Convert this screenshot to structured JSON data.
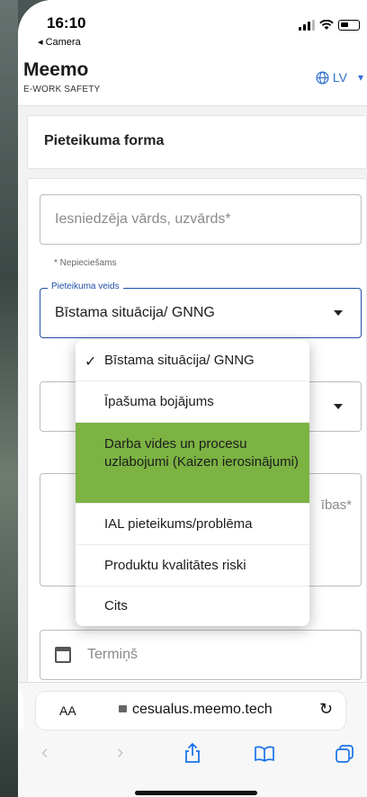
{
  "status_bar": {
    "time": "16:10",
    "back_app": "◂ Camera"
  },
  "app": {
    "name": "Meemo",
    "subtitle": "E-WORK SAFETY",
    "language": "LV"
  },
  "form": {
    "title": "Pieteikuma forma",
    "name_placeholder": "Iesniedzēja vārds, uzvārds*",
    "required_helper": "* Nepieciešams",
    "type_label": "Pieteikuma veids",
    "type_value": "Bīstama situācija/ GNNG",
    "description_tail": "ības*",
    "deadline_placeholder": "Termiņš"
  },
  "dropdown": {
    "options": [
      "Bīstama situācija/ GNNG",
      "Īpašuma bojājums",
      "Darba vides un procesu uzlabojumi (Kaizen ierosinājumi)",
      "IAL pieteikums/problēma",
      "Produktu kvalitātes riski",
      "Cits"
    ],
    "selected_index": 0,
    "highlighted_index": 2,
    "highlight_color": "#7cb342"
  },
  "browser": {
    "aa_label": "AA",
    "url": "cesualus.meemo.tech",
    "reload_icon": "reload-icon",
    "back_icon": "chevron-left-icon",
    "forward_icon": "chevron-right-icon",
    "share_icon": "share-icon",
    "bookmarks_icon": "book-icon",
    "tabs_icon": "tabs-icon"
  },
  "colors": {
    "accent": "#1f4fa8",
    "lang_link": "#2f6fd0"
  }
}
